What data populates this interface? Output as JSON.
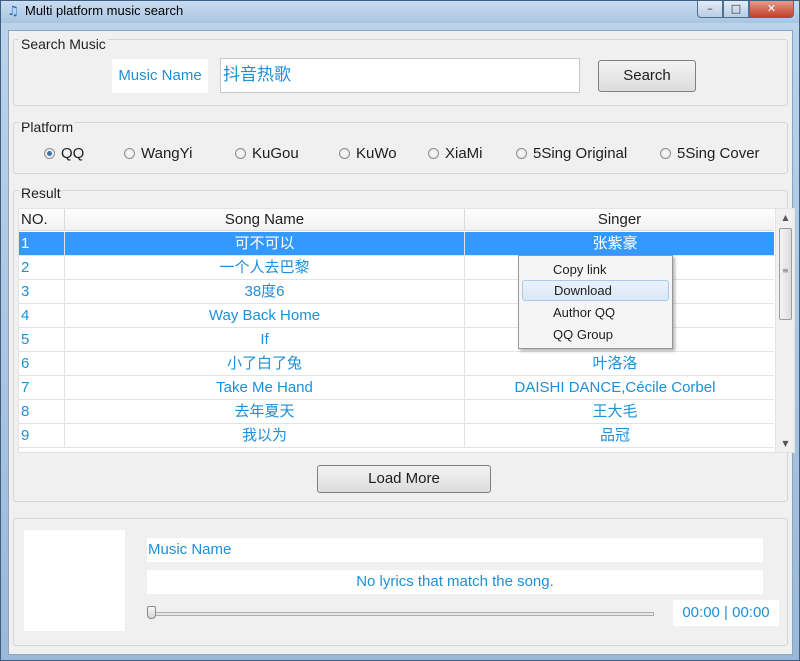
{
  "window": {
    "title": "Multi platform music search",
    "controls": {
      "minimize": "–",
      "maximize": "□",
      "close": "✕"
    }
  },
  "search": {
    "group_title": "Search Music",
    "field_label": "Music Name",
    "query": "抖音热歌",
    "button": "Search"
  },
  "platform": {
    "group_title": "Platform",
    "options": [
      "QQ",
      "WangYi",
      "KuGou",
      "KuWo",
      "XiaMi",
      "5Sing Original",
      "5Sing Cover"
    ],
    "selected": "QQ"
  },
  "result": {
    "group_title": "Result",
    "columns": {
      "no": "NO.",
      "song": "Song Name",
      "singer": "Singer"
    },
    "rows": [
      {
        "no": "1",
        "song": "可不可以",
        "singer": "张紫豪",
        "selected": true
      },
      {
        "no": "2",
        "song": "一个人去巴黎",
        "singer": ""
      },
      {
        "no": "3",
        "song": "38度6",
        "singer": ""
      },
      {
        "no": "4",
        "song": "Way Back Home",
        "singer": ""
      },
      {
        "no": "5",
        "song": "If",
        "singer": ""
      },
      {
        "no": "6",
        "song": "小了白了兔",
        "singer": "叶洛洛"
      },
      {
        "no": "7",
        "song": "Take Me Hand",
        "singer": "DAISHI DANCE,Cécile Corbel"
      },
      {
        "no": "8",
        "song": "去年夏天",
        "singer": "王大毛"
      },
      {
        "no": "9",
        "song": "我以为",
        "singer": "品冠"
      }
    ],
    "load_more": "Load More"
  },
  "context_menu": {
    "items": [
      "Copy link",
      "Download",
      "Author QQ",
      "QQ Group"
    ],
    "highlighted": "Download"
  },
  "player": {
    "music_name": "Music Name",
    "lyrics": "No lyrics that match the song.",
    "time": "00:00 | 00:00",
    "progress": 0
  },
  "colors": {
    "accent_text": "#1e8fd8",
    "selection": "#3399ff"
  }
}
